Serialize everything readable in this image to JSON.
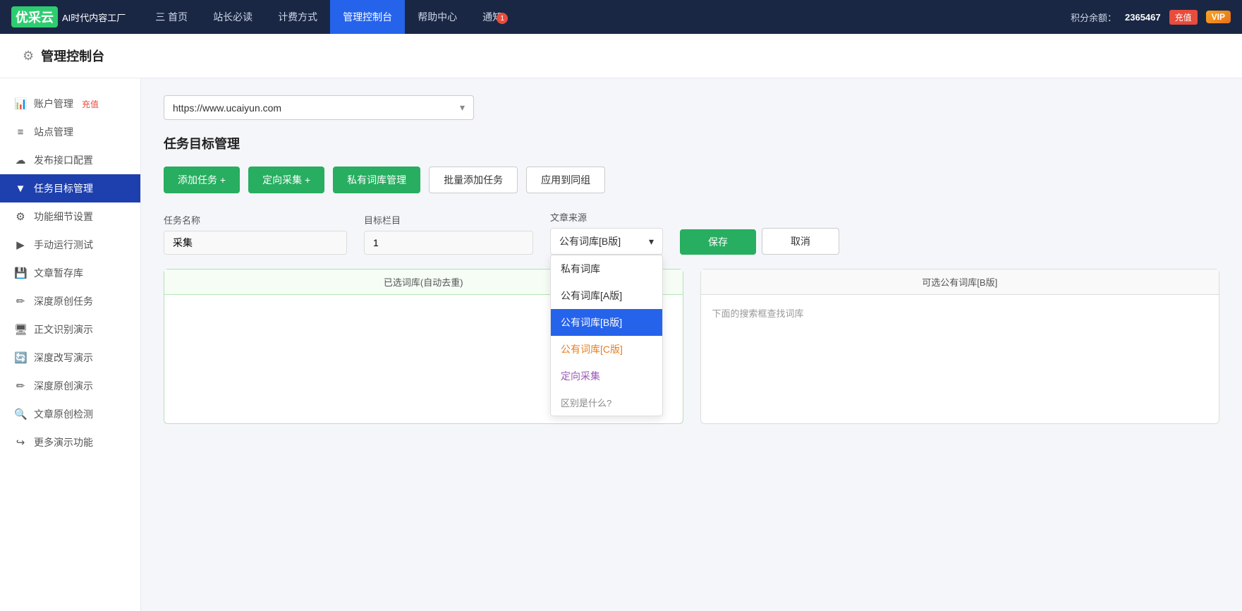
{
  "topnav": {
    "logo_text": "AI时代内容工厂",
    "logo_brand": "优采云",
    "nav_items": [
      {
        "label": "三 首页",
        "active": false
      },
      {
        "label": "站长必读",
        "active": false
      },
      {
        "label": "计费方式",
        "active": false
      },
      {
        "label": "管理控制台",
        "active": true
      },
      {
        "label": "帮助中心",
        "active": false
      },
      {
        "label": "通知",
        "active": false
      }
    ],
    "notification_badge": "1",
    "points_label": "积分余额：",
    "points_value": "2365467",
    "recharge_label": "充值",
    "vip_label": "VIP"
  },
  "page_header": {
    "icon": "⚙",
    "title": "管理控制台"
  },
  "sidebar": {
    "items": [
      {
        "label": "账户管理",
        "icon": "📊",
        "extra": "充值",
        "active": false,
        "name": "account-management"
      },
      {
        "label": "站点管理",
        "icon": "≡",
        "active": false,
        "name": "site-management"
      },
      {
        "label": "发布接口配置",
        "icon": "☁",
        "active": false,
        "name": "publish-config"
      },
      {
        "label": "任务目标管理",
        "icon": "▼",
        "active": true,
        "name": "task-management"
      },
      {
        "label": "功能细节设置",
        "icon": "⚙",
        "active": false,
        "name": "feature-settings"
      },
      {
        "label": "手动运行测试",
        "icon": "▶",
        "active": false,
        "name": "manual-test"
      },
      {
        "label": "文章暂存库",
        "icon": "💾",
        "active": false,
        "name": "article-draft"
      },
      {
        "label": "深度原创任务",
        "icon": "✏",
        "active": false,
        "name": "deep-original"
      },
      {
        "label": "正文识别演示",
        "icon": "🖥",
        "active": false,
        "name": "text-recognition"
      },
      {
        "label": "深度改写演示",
        "icon": "🔄",
        "active": false,
        "name": "deep-rewrite"
      },
      {
        "label": "深度原创演示",
        "icon": "✏",
        "active": false,
        "name": "deep-original-demo"
      },
      {
        "label": "文章原创检测",
        "icon": "🔍",
        "active": false,
        "name": "original-check"
      },
      {
        "label": "更多演示功能",
        "icon": "↪",
        "active": false,
        "name": "more-demo"
      }
    ]
  },
  "main": {
    "url_dropdown": {
      "value": "https://www.ucaiyun.com",
      "placeholder": "https://www.ucaiyun.com"
    },
    "section_title": "任务目标管理",
    "buttons": {
      "add_task": "添加任务 +",
      "directed_collect": "定向采集 +",
      "private_library": "私有词库管理",
      "batch_add": "批量添加任务",
      "apply_group": "应用到同组"
    },
    "form": {
      "task_name_label": "任务名称",
      "task_name_value": "采集",
      "target_column_label": "目标栏目",
      "target_column_value": "1",
      "source_label": "文章来源",
      "source_value": "公有词库[B版]",
      "save_btn": "保存",
      "cancel_btn": "取消"
    },
    "dropdown_options": [
      {
        "label": "私有词库",
        "type": "normal"
      },
      {
        "label": "公有词库[A版]",
        "type": "normal"
      },
      {
        "label": "公有词库[B版]",
        "type": "selected"
      },
      {
        "label": "公有词库[C版]",
        "type": "c"
      },
      {
        "label": "定向采集",
        "type": "directed"
      },
      {
        "label": "区别是什么?",
        "type": "diff"
      }
    ],
    "left_library": {
      "header": "已选词库(自动去重)"
    },
    "right_library": {
      "header": "可选公有词库[B版]",
      "hint": "下面的搜索框查找词库"
    }
  }
}
